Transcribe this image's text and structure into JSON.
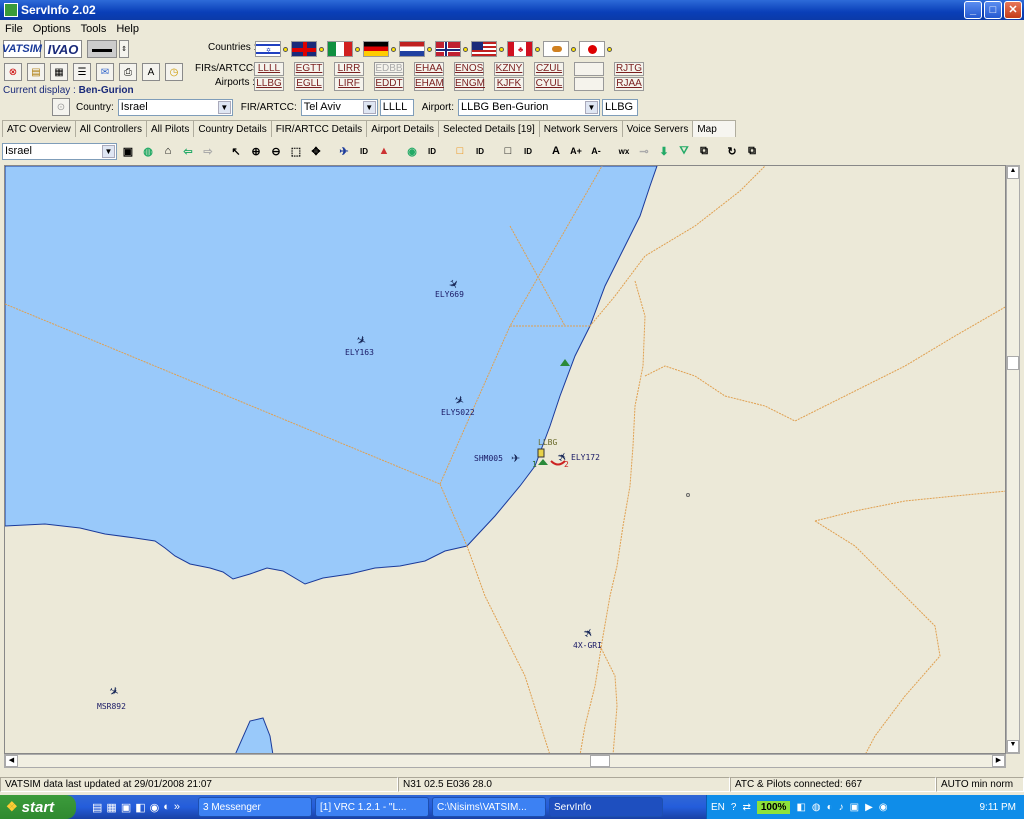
{
  "window": {
    "title": "ServInfo 2.02",
    "minimize": "_",
    "maximize": "□",
    "close": "✕"
  },
  "menu": [
    "File",
    "Options",
    "Tools",
    "Help"
  ],
  "networks": {
    "vatsim": "VATSIM",
    "ivao": "IVAO"
  },
  "labels": {
    "countries": "Countries :",
    "firs": "FIRs/ARTCCs:",
    "airports": "Airports :",
    "current_display_prefix": "Current display :",
    "current_display_value": "Ben-Gurion",
    "country": "Country:",
    "fir": "FIR/ARTCC:",
    "airport": "Airport:"
  },
  "fir_codes": [
    "LLLL",
    "EGTT",
    "LIRR",
    "EDBB",
    "EHAA",
    "ENOS",
    "KZNY",
    "CZUL",
    "",
    "RJTG"
  ],
  "airport_codes": [
    "LLBG",
    "EGLL",
    "LIRF",
    "EDDT",
    "EHAM",
    "ENGM",
    "KJFK",
    "CYUL",
    "",
    "RJAA"
  ],
  "selectors": {
    "country": "Israel",
    "fir": "Tel Aviv",
    "fir_code": "LLLL",
    "airport": "LLBG Ben-Gurion",
    "airport_code": "LLBG",
    "map_region": "Israel"
  },
  "tabs": [
    "ATC Overview",
    "All Controllers",
    "All Pilots",
    "Country Details",
    "FIR/ARTCC Details",
    "Airport Details",
    "Selected Details [19]",
    "Network Servers",
    "Voice Servers",
    "Map"
  ],
  "toolbar_text": {
    "id1": "ID",
    "id2": "ID",
    "id3": "ID",
    "id4": "ID",
    "wx": "wx",
    "font_a": "A",
    "font_plus": "A+",
    "font_minus": "A-"
  },
  "map": {
    "colors": {
      "sea": "#99c9fa",
      "land": "#ece9d8",
      "border": "#e0a050",
      "coast": "#1a3a9a"
    },
    "aircraft": [
      {
        "callsign": "ELY669"
      },
      {
        "callsign": "ELY163"
      },
      {
        "callsign": "ELY5022"
      },
      {
        "callsign": "SHM005"
      },
      {
        "callsign": "ELY172"
      },
      {
        "callsign": "4X-GRI"
      },
      {
        "callsign": "MSR892"
      }
    ],
    "airport_label": "LLBG",
    "airport_marks": [
      "1",
      "2"
    ]
  },
  "status": {
    "updated": "VATSIM data last updated at 29/01/2008 21:07",
    "coords": "N31 02.5   E036 28.0",
    "connected": "ATC & Pilots connected: 667",
    "mode": "AUTO min norm"
  },
  "taskbar": {
    "start": "start",
    "tasks": [
      "3 Messenger",
      "[1] VRC 1.2.1 - \"L...",
      "C:\\Nisims\\VATSIM...",
      "ServInfo"
    ],
    "lang": "EN",
    "zoom": "100%",
    "clock": "9:11 PM"
  }
}
